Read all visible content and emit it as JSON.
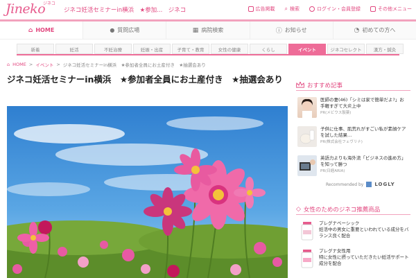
{
  "header": {
    "logo": "Jineko",
    "logo_sub": "ジネコ",
    "page_heading": "ジネコ妊活セミナーin横浜　★参加...　ジネコ",
    "links": [
      {
        "label": "広告掲載",
        "icon": "advertise-icon"
      },
      {
        "label": "検索",
        "icon": "search-icon"
      },
      {
        "label": "ログイン・会員登録",
        "icon": "login-icon"
      },
      {
        "label": "その他メニュー",
        "icon": "menu-icon"
      }
    ]
  },
  "mainnav": {
    "items": [
      {
        "label": "HOME",
        "icon": "home-icon",
        "glyph": "⌂",
        "active": true
      },
      {
        "label": "質問広場",
        "icon": "chat-icon",
        "glyph": "💬",
        "active": false
      },
      {
        "label": "病院検索",
        "icon": "hospital-icon",
        "glyph": "▦",
        "active": false
      },
      {
        "label": "お知らせ",
        "icon": "info-icon",
        "glyph": "ⓘ",
        "active": false
      },
      {
        "label": "初めての方へ",
        "icon": "beginner-icon",
        "glyph": "◔",
        "active": false
      }
    ]
  },
  "subnav": {
    "items": [
      "新着",
      "妊活",
      "不妊治療",
      "妊娠・出産",
      "子育て・教育",
      "女性の健康",
      "くらし",
      "イベント",
      "ジネコセレクト",
      "漢方・鍼灸"
    ],
    "active_index": 7
  },
  "breadcrumb": {
    "home": "HOME",
    "sep": ">",
    "event": "イベント",
    "current": "ジネコ妊活セミナーin横浜　★参加者全員にお土産付き　★抽選会あり"
  },
  "article": {
    "title": "ジネコ妊活セミナーin横浜　★参加者全員にお土産付き　★抽選会あり"
  },
  "sidebar": {
    "recommend_heading": "おすすめ記事",
    "recommended": [
      {
        "text": "医師の妻(46)「シミは家で簡単だよ?」お手軽すぎて大炎上中",
        "pr": "PR(メビウス製薬)"
      },
      {
        "text": "子供に仕事、肌荒れがすごい私が素顔ケアを試した結果…",
        "pr": "PR(株式会社フェヴリナ)"
      },
      {
        "text": "英語力よりも海外流「ビジネスの進め方」を知って勝つ",
        "pr": "PR(日経ARIA)"
      }
    ],
    "recommended_by": "Recommended by",
    "logly": "LOGLY",
    "products_heading": "女性のためのジネコ推薦商品",
    "products": [
      {
        "name": "プレグナベーシック",
        "desc": "妊活中の男女に重要といわれている成分をバランス良く配合"
      },
      {
        "name": "プレグナ女性用",
        "desc": "特に女性に摂っていただきたい妊活サポート成分を配合"
      }
    ]
  },
  "colors": {
    "brand_pink": "#e2477f",
    "accent_pink": "#ee6c98",
    "sky_blue": "#3a88d6"
  }
}
